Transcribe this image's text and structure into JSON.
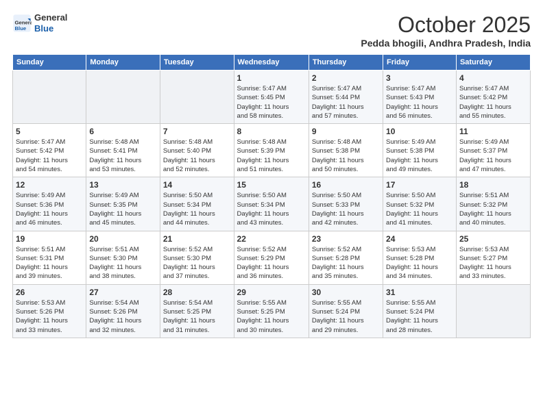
{
  "header": {
    "logo": {
      "general": "General",
      "blue": "Blue"
    },
    "title": "October 2025",
    "location": "Pedda bhogili, Andhra Pradesh, India"
  },
  "columns": [
    "Sunday",
    "Monday",
    "Tuesday",
    "Wednesday",
    "Thursday",
    "Friday",
    "Saturday"
  ],
  "weeks": [
    [
      {
        "day": "",
        "info": ""
      },
      {
        "day": "",
        "info": ""
      },
      {
        "day": "",
        "info": ""
      },
      {
        "day": "1",
        "info": "Sunrise: 5:47 AM\nSunset: 5:45 PM\nDaylight: 11 hours\nand 58 minutes."
      },
      {
        "day": "2",
        "info": "Sunrise: 5:47 AM\nSunset: 5:44 PM\nDaylight: 11 hours\nand 57 minutes."
      },
      {
        "day": "3",
        "info": "Sunrise: 5:47 AM\nSunset: 5:43 PM\nDaylight: 11 hours\nand 56 minutes."
      },
      {
        "day": "4",
        "info": "Sunrise: 5:47 AM\nSunset: 5:42 PM\nDaylight: 11 hours\nand 55 minutes."
      }
    ],
    [
      {
        "day": "5",
        "info": "Sunrise: 5:47 AM\nSunset: 5:42 PM\nDaylight: 11 hours\nand 54 minutes."
      },
      {
        "day": "6",
        "info": "Sunrise: 5:48 AM\nSunset: 5:41 PM\nDaylight: 11 hours\nand 53 minutes."
      },
      {
        "day": "7",
        "info": "Sunrise: 5:48 AM\nSunset: 5:40 PM\nDaylight: 11 hours\nand 52 minutes."
      },
      {
        "day": "8",
        "info": "Sunrise: 5:48 AM\nSunset: 5:39 PM\nDaylight: 11 hours\nand 51 minutes."
      },
      {
        "day": "9",
        "info": "Sunrise: 5:48 AM\nSunset: 5:38 PM\nDaylight: 11 hours\nand 50 minutes."
      },
      {
        "day": "10",
        "info": "Sunrise: 5:49 AM\nSunset: 5:38 PM\nDaylight: 11 hours\nand 49 minutes."
      },
      {
        "day": "11",
        "info": "Sunrise: 5:49 AM\nSunset: 5:37 PM\nDaylight: 11 hours\nand 47 minutes."
      }
    ],
    [
      {
        "day": "12",
        "info": "Sunrise: 5:49 AM\nSunset: 5:36 PM\nDaylight: 11 hours\nand 46 minutes."
      },
      {
        "day": "13",
        "info": "Sunrise: 5:49 AM\nSunset: 5:35 PM\nDaylight: 11 hours\nand 45 minutes."
      },
      {
        "day": "14",
        "info": "Sunrise: 5:50 AM\nSunset: 5:34 PM\nDaylight: 11 hours\nand 44 minutes."
      },
      {
        "day": "15",
        "info": "Sunrise: 5:50 AM\nSunset: 5:34 PM\nDaylight: 11 hours\nand 43 minutes."
      },
      {
        "day": "16",
        "info": "Sunrise: 5:50 AM\nSunset: 5:33 PM\nDaylight: 11 hours\nand 42 minutes."
      },
      {
        "day": "17",
        "info": "Sunrise: 5:50 AM\nSunset: 5:32 PM\nDaylight: 11 hours\nand 41 minutes."
      },
      {
        "day": "18",
        "info": "Sunrise: 5:51 AM\nSunset: 5:32 PM\nDaylight: 11 hours\nand 40 minutes."
      }
    ],
    [
      {
        "day": "19",
        "info": "Sunrise: 5:51 AM\nSunset: 5:31 PM\nDaylight: 11 hours\nand 39 minutes."
      },
      {
        "day": "20",
        "info": "Sunrise: 5:51 AM\nSunset: 5:30 PM\nDaylight: 11 hours\nand 38 minutes."
      },
      {
        "day": "21",
        "info": "Sunrise: 5:52 AM\nSunset: 5:30 PM\nDaylight: 11 hours\nand 37 minutes."
      },
      {
        "day": "22",
        "info": "Sunrise: 5:52 AM\nSunset: 5:29 PM\nDaylight: 11 hours\nand 36 minutes."
      },
      {
        "day": "23",
        "info": "Sunrise: 5:52 AM\nSunset: 5:28 PM\nDaylight: 11 hours\nand 35 minutes."
      },
      {
        "day": "24",
        "info": "Sunrise: 5:53 AM\nSunset: 5:28 PM\nDaylight: 11 hours\nand 34 minutes."
      },
      {
        "day": "25",
        "info": "Sunrise: 5:53 AM\nSunset: 5:27 PM\nDaylight: 11 hours\nand 33 minutes."
      }
    ],
    [
      {
        "day": "26",
        "info": "Sunrise: 5:53 AM\nSunset: 5:26 PM\nDaylight: 11 hours\nand 33 minutes."
      },
      {
        "day": "27",
        "info": "Sunrise: 5:54 AM\nSunset: 5:26 PM\nDaylight: 11 hours\nand 32 minutes."
      },
      {
        "day": "28",
        "info": "Sunrise: 5:54 AM\nSunset: 5:25 PM\nDaylight: 11 hours\nand 31 minutes."
      },
      {
        "day": "29",
        "info": "Sunrise: 5:55 AM\nSunset: 5:25 PM\nDaylight: 11 hours\nand 30 minutes."
      },
      {
        "day": "30",
        "info": "Sunrise: 5:55 AM\nSunset: 5:24 PM\nDaylight: 11 hours\nand 29 minutes."
      },
      {
        "day": "31",
        "info": "Sunrise: 5:55 AM\nSunset: 5:24 PM\nDaylight: 11 hours\nand 28 minutes."
      },
      {
        "day": "",
        "info": ""
      }
    ]
  ]
}
